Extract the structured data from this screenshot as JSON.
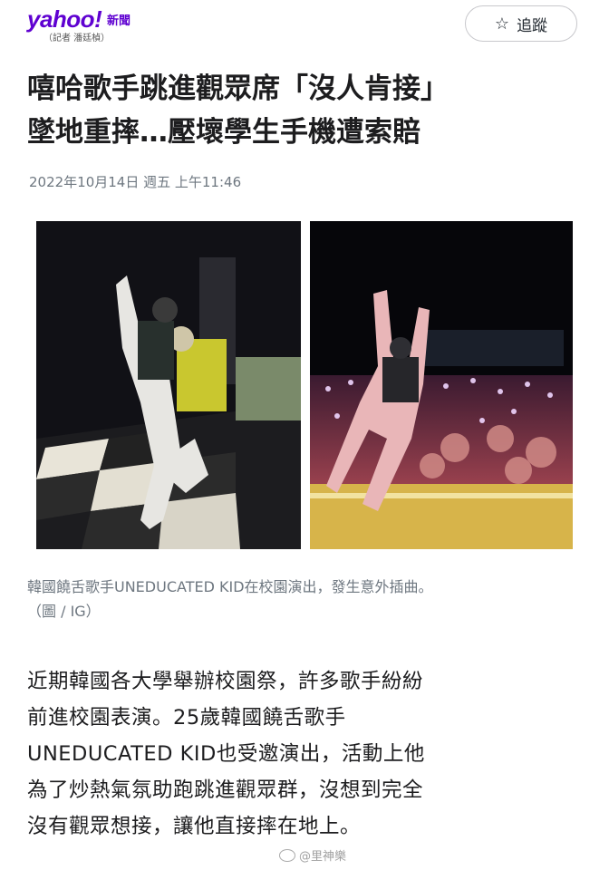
{
  "header": {
    "logo": "yahoo!",
    "section": "新聞",
    "reporter": "（記者 潘廷楨）",
    "follow_label": "追蹤",
    "follow_icon": "star-outline-icon"
  },
  "article": {
    "title_line1": "嘻哈歌手跳進觀眾席「沒人肯接」",
    "title_line2": "墜地重摔…壓壞學生手機遭索賠",
    "date": "2022年10月14日 週五 上午11:46",
    "caption_line1": "韓國饒舌歌手UNEDUCATED KID在校園演出，發生意外插曲。",
    "caption_line2": "（圖 / IG）",
    "body_lines": [
      "近期韓國各大學舉辦校園祭，許多歌手紛紛",
      "前進校園表演。25歲韓國饒舌歌手",
      "UNEDUCATED KID也受邀演出，活動上他",
      "為了炒熱氣氛助跑跳進觀眾群，沒想到完全",
      "沒有觀眾想接，讓他直接摔在地上。"
    ]
  },
  "watermark": "@里神樂",
  "colors": {
    "brand": "#5f01d1",
    "meta": "#6e7780",
    "text": "#1d1d1f"
  }
}
